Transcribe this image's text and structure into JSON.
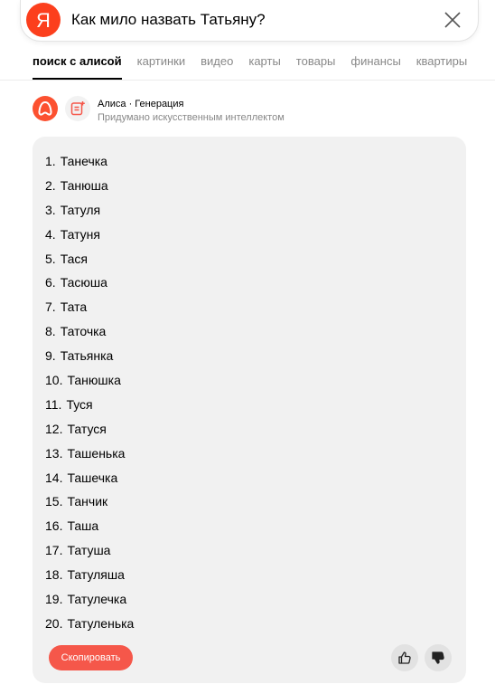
{
  "search": {
    "query": "Как мило назвать Татьяну?",
    "logo_letter": "Я"
  },
  "tabs": [
    {
      "label": "поиск с алисой",
      "active": true
    },
    {
      "label": "картинки"
    },
    {
      "label": "видео"
    },
    {
      "label": "карты"
    },
    {
      "label": "товары"
    },
    {
      "label": "финансы"
    },
    {
      "label": "квартиры"
    }
  ],
  "answer": {
    "title": "Алиса · Генерация",
    "subtitle": "Придумано искусственным интеллектом",
    "items": [
      {
        "num": "1.",
        "name": "Танечка"
      },
      {
        "num": "2.",
        "name": "Танюша"
      },
      {
        "num": "3.",
        "name": "Татуля"
      },
      {
        "num": "4.",
        "name": "Татуня"
      },
      {
        "num": "5.",
        "name": "Тася"
      },
      {
        "num": "6.",
        "name": "Тасюша"
      },
      {
        "num": "7.",
        "name": "Тата"
      },
      {
        "num": "8.",
        "name": "Таточка"
      },
      {
        "num": "9.",
        "name": "Татьянка"
      },
      {
        "num": "10.",
        "name": "Танюшка"
      },
      {
        "num": "11.",
        "name": "Туся"
      },
      {
        "num": "12.",
        "name": "Татуся"
      },
      {
        "num": "13.",
        "name": "Ташенька"
      },
      {
        "num": "14.",
        "name": "Ташечка"
      },
      {
        "num": "15.",
        "name": "Танчик"
      },
      {
        "num": "16.",
        "name": "Таша"
      },
      {
        "num": "17.",
        "name": "Татуша"
      },
      {
        "num": "18.",
        "name": "Татуляша"
      },
      {
        "num": "19.",
        "name": "Татулечка"
      },
      {
        "num": "20.",
        "name": "Татуленька"
      }
    ],
    "copy_label": "Скопировать"
  },
  "colors": {
    "brand": "#fc3f1d",
    "copy_button": "#f5574a",
    "card_bg": "#f1f1f1"
  }
}
